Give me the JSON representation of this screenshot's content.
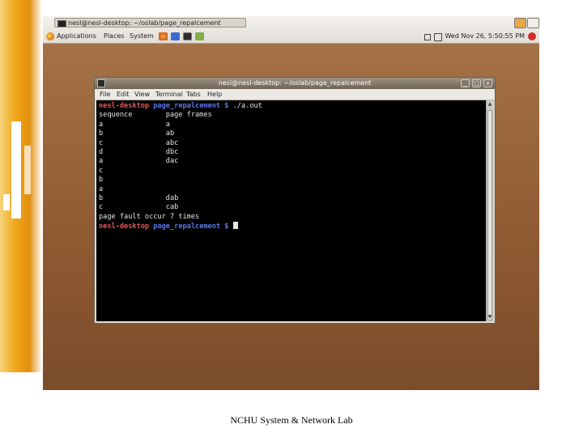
{
  "footer": {
    "text": "NCHU System & Network Lab"
  },
  "gnome_panel": {
    "taskbar_title": "nesl@nesl-desktop: ~/oslab/page_repalcement",
    "menus": [
      "Applications",
      "Places",
      "System"
    ],
    "clock": "Wed Nov 26, 5:50:55 PM"
  },
  "terminal": {
    "title": "nesl@nesl-desktop: ~/oslab/page_repalcement",
    "menu": [
      "File",
      "Edit",
      "View",
      "Terminal",
      "Tabs",
      "Help"
    ],
    "lines": [
      {
        "type": "prompt",
        "host": "nesl-desktop",
        "dir": "page_repalcement",
        "sign": "$",
        "cmd": " ./a.out"
      },
      {
        "type": "text",
        "text": "sequence        page frames"
      },
      {
        "type": "text",
        "text": "a               a"
      },
      {
        "type": "text",
        "text": "b               ab"
      },
      {
        "type": "text",
        "text": "c               abc"
      },
      {
        "type": "text",
        "text": "d               dbc"
      },
      {
        "type": "text",
        "text": "a               dac"
      },
      {
        "type": "text",
        "text": "c"
      },
      {
        "type": "text",
        "text": "b"
      },
      {
        "type": "text",
        "text": "a"
      },
      {
        "type": "text",
        "text": "b               dab"
      },
      {
        "type": "text",
        "text": "c               cab"
      },
      {
        "type": "text",
        "text": "page fault occur 7 times"
      },
      {
        "type": "prompt",
        "host": "nesl-desktop",
        "dir": "page_repalcement",
        "sign": "$",
        "cmd": " ",
        "cursor": true
      }
    ]
  },
  "colors": {
    "desktop": "#915c33",
    "prompt_host": "#e25757",
    "prompt_dir": "#5b77e8"
  }
}
